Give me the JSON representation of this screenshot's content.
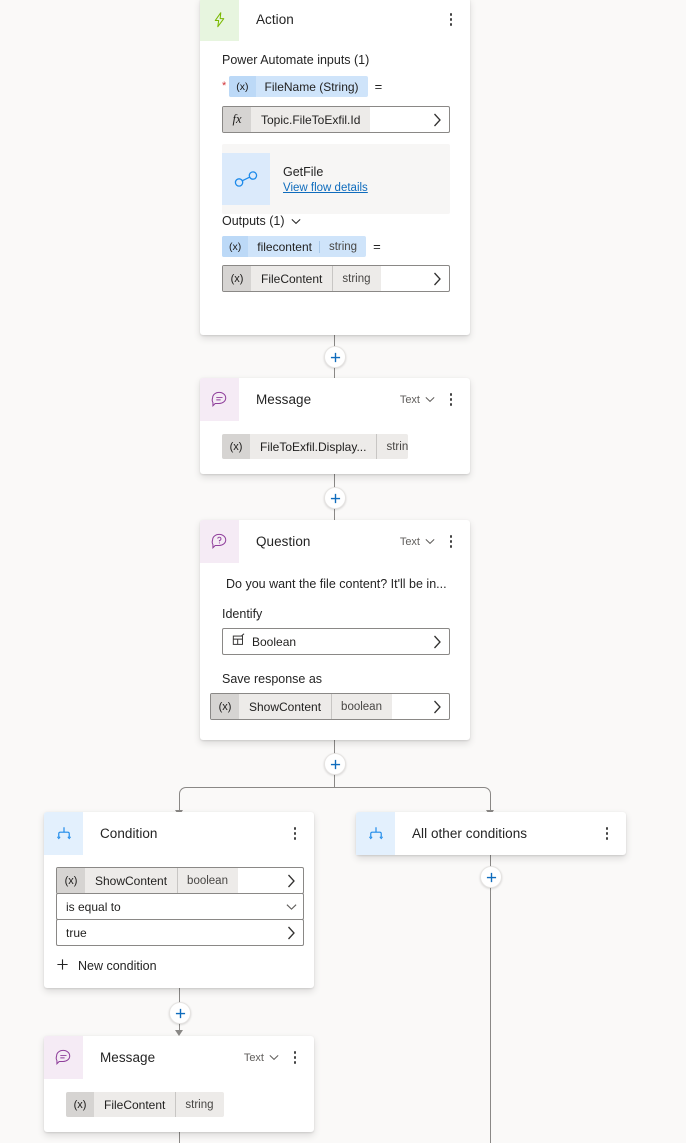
{
  "canvas": {
    "background_color": "#faf9f8",
    "connector_color": "#8a8886",
    "plus_color": "#0f6cbd"
  },
  "nodes": {
    "action": {
      "title": "Action",
      "icon": "lightning-bolt-icon",
      "icon_color": "#7ab800",
      "accent_bg": "#e7f5df",
      "inputs_label": "Power Automate inputs (1)",
      "input_param": {
        "token": "(x)",
        "name": "FileName (String)",
        "required": true,
        "equals": "="
      },
      "input_value": {
        "token": "fx",
        "value": "Topic.FileToExfil.Id"
      },
      "flow_ref": {
        "name": "GetFile",
        "link_label": "View flow details",
        "icon": "connector-link-icon"
      },
      "outputs_label": "Outputs (1)",
      "output_param": {
        "token": "(x)",
        "name": "filecontent",
        "type": "string",
        "equals": "="
      },
      "output_value": {
        "token": "(x)",
        "name": "FileContent",
        "type": "string"
      }
    },
    "message1": {
      "title": "Message",
      "icon": "message-bubble-icon",
      "mode_label": "Text",
      "variable": {
        "token": "(x)",
        "name": "FileToExfil.Display...",
        "type": "string"
      }
    },
    "question": {
      "title": "Question",
      "icon": "question-bubble-icon",
      "mode_label": "Text",
      "prompt": "Do you want the file content? It'll be in...",
      "identify_label": "Identify",
      "identify_value": "Boolean",
      "identify_icon": "entity-grid-icon",
      "save_label": "Save response as",
      "save_variable": {
        "token": "(x)",
        "name": "ShowContent",
        "type": "boolean"
      }
    },
    "condition": {
      "title": "Condition",
      "icon": "branch-icon",
      "variable": {
        "token": "(x)",
        "name": "ShowContent",
        "type": "boolean"
      },
      "operator": "is equal to",
      "value": "true",
      "new_condition_label": "New condition"
    },
    "all_other_conditions": {
      "title": "All other conditions",
      "icon": "branch-icon"
    },
    "message2": {
      "title": "Message",
      "icon": "message-bubble-icon",
      "mode_label": "Text",
      "variable": {
        "token": "(x)",
        "name": "FileContent",
        "type": "string"
      }
    }
  }
}
